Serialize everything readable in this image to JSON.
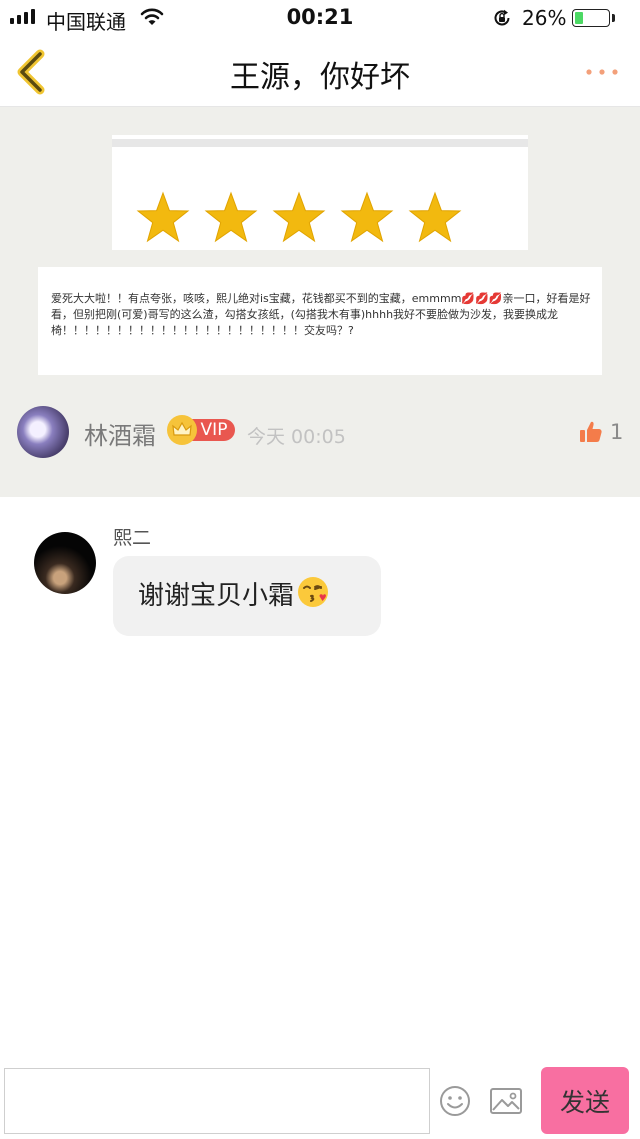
{
  "status_bar": {
    "carrier": "中国联通",
    "time": "00:21",
    "battery_percent_text": "26%",
    "battery_level": 0.26
  },
  "header": {
    "title": "王源，你好坏"
  },
  "post": {
    "star_rating": 5,
    "star_color": "#f2b90f",
    "review_text": "爱死大大啦！！有点夸张，咳咳，熙儿绝对is宝藏，花钱都买不到的宝藏，emmmm💋💋💋亲一口，好看是好看，但别把刚(可爱)哥写的这么渣，勾搭女孩纸，(勾搭我木有事)hhhh我好不要脸做为沙发，我要换成龙椅！！！！！！！！！！！！！！！！！！！！！！交友吗？?",
    "author": "林酒霜",
    "vip_label": "VIP",
    "time": "今天 00:05",
    "like_count": "1",
    "like_color": "#f47c4a"
  },
  "message": {
    "sender": "熙二",
    "text": "谢谢宝贝小霜"
  },
  "input_bar": {
    "placeholder": "",
    "send_label": "发送",
    "send_color": "#f86fa1"
  },
  "icons": {
    "back": "chevron-left-icon",
    "more": "more-dots-icon",
    "like": "thumbs-up-icon",
    "emoji": "smiley-icon",
    "image": "image-icon"
  }
}
